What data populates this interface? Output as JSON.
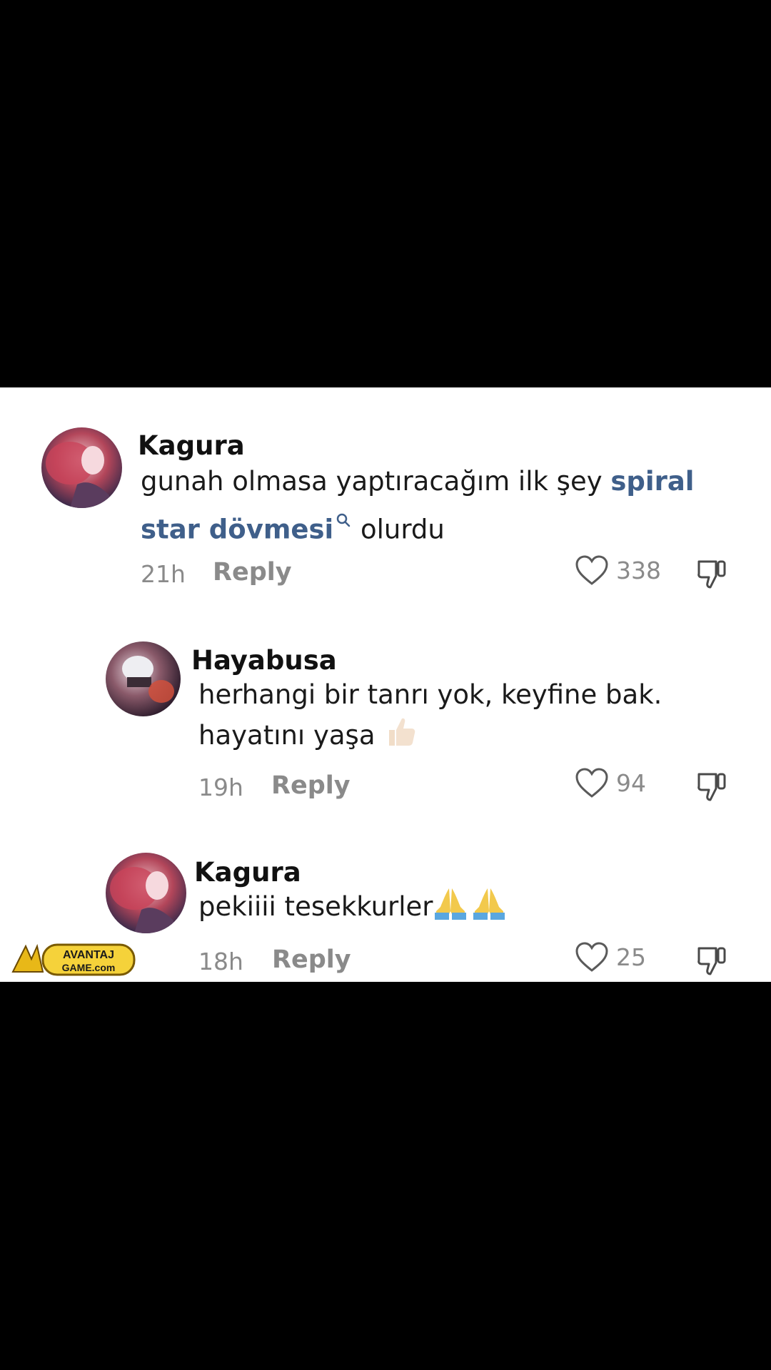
{
  "comments": [
    {
      "username": "Kagura",
      "text_before": "gunah olmasa yaptıracağım ilk şey ",
      "link_line1": "spiral",
      "link_line2": "star dövmesi",
      "text_after": " olurdu",
      "time": "21h",
      "reply_label": "Reply",
      "likes": "338",
      "avatar": "kagura-avatar"
    },
    {
      "username": "Hayabusa",
      "line1": "herhangi bir tanrı yok, keyfine bak.",
      "line2": "hayatını yaşa",
      "emoji": "thumbs-up",
      "time": "19h",
      "reply_label": "Reply",
      "likes": "94",
      "avatar": "hayabusa-avatar"
    },
    {
      "username": "Kagura",
      "text": "pekiiii tesekkurler",
      "emoji": "folded-hands x2",
      "time": "18h",
      "reply_label": "Reply",
      "likes": "25",
      "avatar": "kagura-avatar"
    }
  ],
  "watermark": {
    "text": "AVANTAJ GAME.com"
  },
  "colors": {
    "link": "#3f5f8a",
    "meta": "#8a8a8a",
    "background": "#ffffff"
  }
}
